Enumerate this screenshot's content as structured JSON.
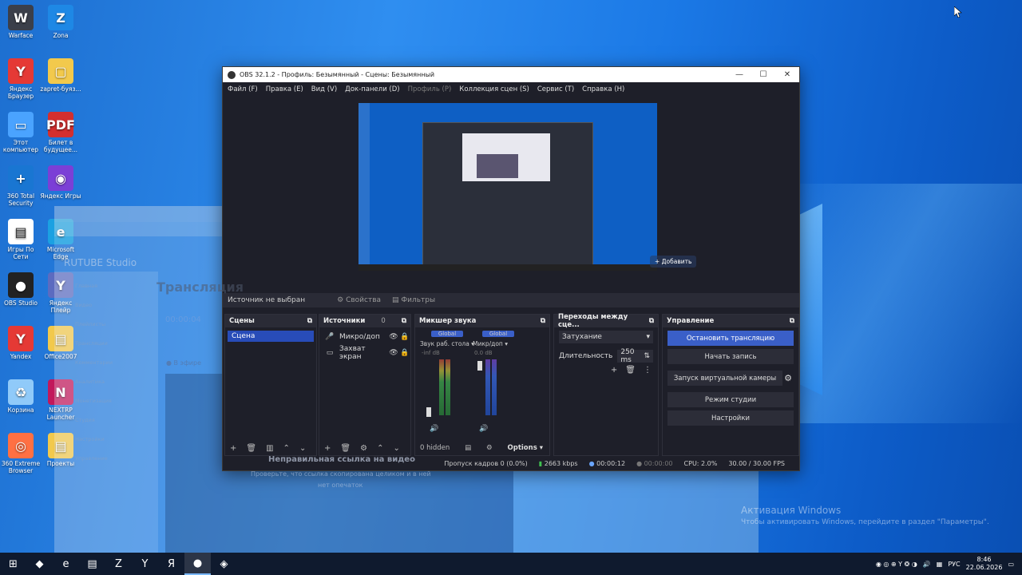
{
  "desktop_icons": [
    {
      "label": "Warface",
      "glyph": "W",
      "color": "#3b3f4a"
    },
    {
      "label": "Zona",
      "glyph": "Z",
      "color": "#1e88e5"
    },
    {
      "label": "Яндекс Браузер",
      "glyph": "Y",
      "color": "#e53935"
    },
    {
      "label": "zapret-буяз...",
      "glyph": "▢",
      "color": "#f2c94c"
    },
    {
      "label": "Этот компьютер",
      "glyph": "▭",
      "color": "#4aa3ff"
    },
    {
      "label": "Билет в будущее...",
      "glyph": "PDF",
      "color": "#d32f2f"
    },
    {
      "label": "360 Total Security",
      "glyph": "+",
      "color": "#1976d2"
    },
    {
      "label": "Яндекс Игры",
      "glyph": "◉",
      "color": "#7b3fd6"
    },
    {
      "label": "Игры По Сети",
      "glyph": "▤",
      "color": "#ffffff"
    },
    {
      "label": "Microsoft Edge",
      "glyph": "e",
      "color": "#1ba1e2"
    },
    {
      "label": "OBS Studio",
      "glyph": "●",
      "color": "#222222"
    },
    {
      "label": "Яндекс Плейр",
      "glyph": "Y",
      "color": "#5c6bc0"
    },
    {
      "label": "Yandex",
      "glyph": "Y",
      "color": "#e53935"
    },
    {
      "label": "Office2007",
      "glyph": "▤",
      "color": "#f2c94c"
    },
    {
      "label": "Корзина",
      "glyph": "♻",
      "color": "#90caf9"
    },
    {
      "label": "NEXTRP Launcher",
      "glyph": "N",
      "color": "#c2185b"
    },
    {
      "label": "360 Extreme Browser",
      "glyph": "◎",
      "color": "#ff7043"
    },
    {
      "label": "Проекты",
      "glyph": "▤",
      "color": "#f2c94c"
    }
  ],
  "ghost": {
    "studio": "RUTUBE Studio",
    "heading": "Трансляция",
    "timer": "00:00:04",
    "onair": "● В эфире",
    "error_title": "Неправильная ссылка на видео",
    "error_body1": "Проверьте, что ссылка скопирована целиком и в ней",
    "error_body2": "нет опечаток",
    "add": "+ Добавить",
    "sidebar": [
      "Главная",
      "Видео",
      "Плейлисты",
      "Трансляции",
      "Комментарии",
      "Аналитика",
      "Монетизация",
      "Студия",
      "Настройки",
      "Управление"
    ]
  },
  "obs": {
    "title": "OBS 32.1.2 - Профиль: Безымянный - Сцены: Безымянный",
    "menu": [
      {
        "label": "Файл (F)",
        "dim": false
      },
      {
        "label": "Правка (E)",
        "dim": false
      },
      {
        "label": "Вид (V)",
        "dim": false
      },
      {
        "label": "Док-панели (D)",
        "dim": false
      },
      {
        "label": "Профиль (P)",
        "dim": true
      },
      {
        "label": "Коллекция сцен (S)",
        "dim": false
      },
      {
        "label": "Сервис (T)",
        "dim": false
      },
      {
        "label": "Справка (H)",
        "dim": false
      }
    ],
    "source_bar": {
      "none": "Источник не выбран",
      "props": "⚙ Свойства",
      "filters": "▤ Фильтры"
    },
    "scenes": {
      "title": "Сцены",
      "items": [
        "Сцена"
      ]
    },
    "sources": {
      "title": "Источники",
      "count": "0",
      "items": [
        {
          "icon": "🎤",
          "name": "Микро/доп"
        },
        {
          "icon": "▭",
          "name": "Захват экран"
        }
      ]
    },
    "mixer": {
      "title": "Микшер звука",
      "ch1": "Global",
      "ch2": "Global",
      "lbl1": "Звук раб. стола ▾",
      "lbl2": "Микр/доп ▾",
      "db1": "-inf dB",
      "db2": "0.0 dB",
      "hidden": "0 hidden",
      "options": "Options ▾"
    },
    "transitions": {
      "title": "Переходы между сце...",
      "selected": "Затухание",
      "duration_label": "Длительность",
      "duration_value": "250 ms"
    },
    "controls": {
      "title": "Управление",
      "stop_stream": "Остановить трансляцию",
      "start_record": "Начать запись",
      "virtual_cam": "Запуск виртуальной камеры",
      "studio_mode": "Режим студии",
      "settings": "Настройки"
    },
    "status": {
      "dropped": "Пропуск кадров 0 (0.0%)",
      "bitrate": "2663 kbps",
      "stream_time": "00:00:12",
      "rec_time": "00:00:00",
      "cpu": "CPU: 2.0%",
      "fps": "30.00 / 30.00 FPS"
    }
  },
  "activation": {
    "line1": "Активация Windows",
    "line2": "Чтобы активировать Windows, перейдите в раздел \"Параметры\"."
  },
  "taskbar": {
    "apps": [
      "⊞",
      "◆",
      "e",
      "▤",
      "Z",
      "Y",
      "Я",
      "●",
      "◈"
    ],
    "active_index": 7,
    "lang": "РУС",
    "time": "8:46",
    "date": "22.06.2026"
  }
}
